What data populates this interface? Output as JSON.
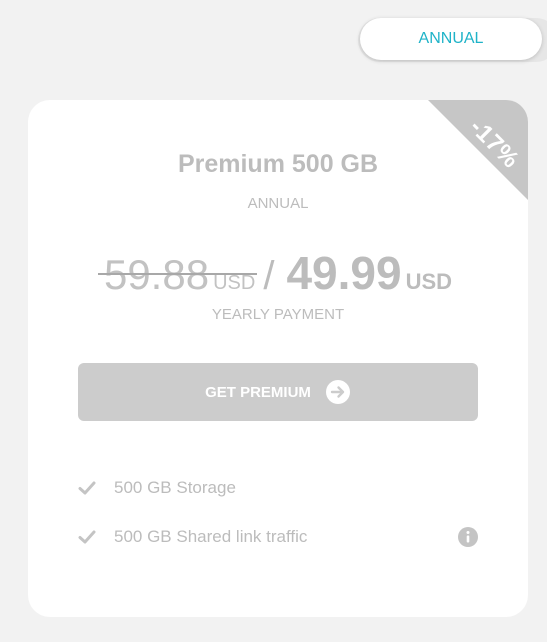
{
  "billing_toggle": {
    "selected_label": "ANNUAL"
  },
  "colors": {
    "accent": "#1fb3c8",
    "muted_text": "#bcbcbc",
    "button_bg": "#cccccc",
    "ribbon_bg": "#c6c6c6"
  },
  "plan": {
    "discount_badge": "-17%",
    "title": "Premium 500 GB",
    "period": "ANNUAL",
    "old_price": {
      "amount": "59.88",
      "currency": "USD"
    },
    "separator": "/",
    "new_price": {
      "amount": "49.99",
      "currency": "USD"
    },
    "payment_label": "YEARLY PAYMENT",
    "cta_label": "GET PREMIUM",
    "cta_icon": "arrow-right-circle-icon",
    "features": [
      {
        "label": "500 GB Storage",
        "icon": "check-icon"
      },
      {
        "label": "500 GB Shared link traffic",
        "icon": "check-icon",
        "info_icon": "info-icon"
      }
    ]
  }
}
